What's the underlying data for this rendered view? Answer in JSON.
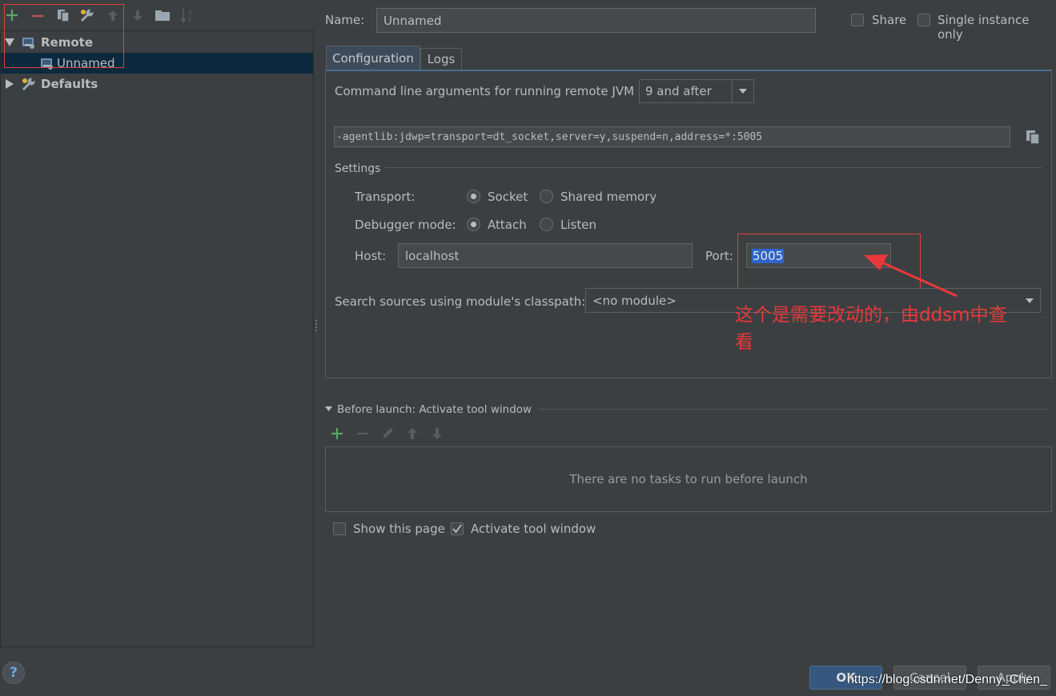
{
  "toolbar": {
    "icons": [
      "add-icon",
      "remove-icon",
      "copy-icon",
      "wrench-icon",
      "arrow-up-icon",
      "arrow-down-icon",
      "folder-icon",
      "sort-az-icon"
    ]
  },
  "tree": {
    "remote_label": "Remote",
    "unnamed_label": "Unnamed",
    "defaults_label": "Defaults"
  },
  "header": {
    "name_label": "Name:",
    "name_value": "Unnamed",
    "share_label": "Share",
    "single_instance_label": "Single instance only"
  },
  "tabs": [
    "Configuration",
    "Logs"
  ],
  "config": {
    "cmd_label": "Command line arguments for running remote JVM",
    "jvm_version": "9 and after",
    "cmd_value": "-agentlib:jdwp=transport=dt_socket,server=y,suspend=n,address=*:5005",
    "settings_title": "Settings",
    "transport_label": "Transport:",
    "transport_socket": "Socket",
    "transport_shared": "Shared memory",
    "mode_label": "Debugger mode:",
    "mode_attach": "Attach",
    "mode_listen": "Listen",
    "host_label": "Host:",
    "host_value": "localhost",
    "port_label": "Port:",
    "port_value": "5005",
    "module_label": "Search sources using module's classpath:",
    "module_value": "<no module>"
  },
  "annotation": {
    "text_line1": "这个是需要改动的，由ddsm中查",
    "text_line2": "看",
    "color": "#e8383b"
  },
  "before_launch": {
    "title": "Before launch: Activate tool window",
    "empty_text": "There are no tasks to run before launch",
    "show_page_label": "Show this page",
    "activate_label": "Activate tool window"
  },
  "footer": {
    "help": "?",
    "ok": "OK",
    "cancel": "Cancel",
    "apply": "Apply",
    "watermark": "https://blog.csdn.net/Denny_Chen_"
  },
  "colors": {
    "background": "#3c3f41",
    "field": "#45494a",
    "selection": "#0d293e",
    "accent": "#365880",
    "add_green": "#59a869",
    "remove_red": "#c75450"
  }
}
